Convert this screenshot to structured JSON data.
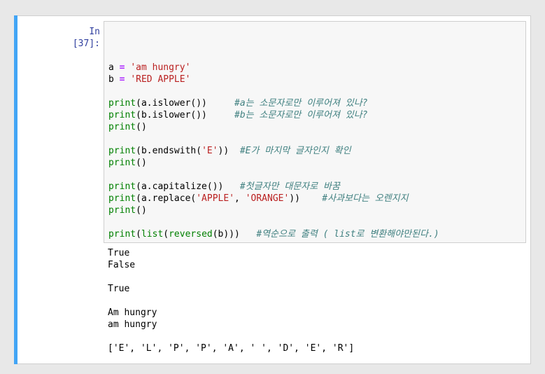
{
  "cell": {
    "prompt": "In [37]:",
    "code_lines": [
      {
        "tokens": []
      },
      {
        "tokens": [
          [
            "plain",
            "a "
          ],
          [
            "op",
            "="
          ],
          [
            "plain",
            " "
          ],
          [
            "str",
            "'am hungry'"
          ]
        ]
      },
      {
        "tokens": [
          [
            "plain",
            "b "
          ],
          [
            "op",
            "="
          ],
          [
            "plain",
            " "
          ],
          [
            "str",
            "'RED APPLE'"
          ]
        ]
      },
      {
        "tokens": []
      },
      {
        "tokens": [
          [
            "fn",
            "print"
          ],
          [
            "plain",
            "(a.islower())     "
          ],
          [
            "cm",
            "#a는 소문자로만 이루어져 있나?"
          ]
        ]
      },
      {
        "tokens": [
          [
            "fn",
            "print"
          ],
          [
            "plain",
            "(b.islower())     "
          ],
          [
            "cm",
            "#b는 소문자로만 이루어져 있나?"
          ]
        ]
      },
      {
        "tokens": [
          [
            "fn",
            "print"
          ],
          [
            "plain",
            "()"
          ]
        ]
      },
      {
        "tokens": []
      },
      {
        "tokens": [
          [
            "fn",
            "print"
          ],
          [
            "plain",
            "(b.endswith("
          ],
          [
            "str",
            "'E'"
          ],
          [
            "plain",
            "))  "
          ],
          [
            "cm",
            "#E가 마지막 글자인지 확인"
          ]
        ]
      },
      {
        "tokens": [
          [
            "fn",
            "print"
          ],
          [
            "plain",
            "()"
          ]
        ]
      },
      {
        "tokens": []
      },
      {
        "tokens": [
          [
            "fn",
            "print"
          ],
          [
            "plain",
            "(a.capitalize())   "
          ],
          [
            "cm",
            "#첫글자만 대문자로 바꿈"
          ]
        ]
      },
      {
        "tokens": [
          [
            "fn",
            "print"
          ],
          [
            "plain",
            "(a.replace("
          ],
          [
            "str",
            "'APPLE'"
          ],
          [
            "plain",
            ", "
          ],
          [
            "str",
            "'ORANGE'"
          ],
          [
            "plain",
            "))    "
          ],
          [
            "cm",
            "#사과보다는 오렌지지"
          ]
        ]
      },
      {
        "tokens": [
          [
            "fn",
            "print"
          ],
          [
            "plain",
            "()"
          ]
        ]
      },
      {
        "tokens": []
      },
      {
        "tokens": [
          [
            "fn",
            "print"
          ],
          [
            "plain",
            "("
          ],
          [
            "fn",
            "list"
          ],
          [
            "plain",
            "("
          ],
          [
            "fn",
            "reversed"
          ],
          [
            "plain",
            "(b)))   "
          ],
          [
            "cm",
            "#역순으로 출력 ( list로 변환해야만된다.)"
          ]
        ]
      }
    ],
    "output_lines": [
      "True",
      "False",
      "",
      "True",
      "",
      "Am hungry",
      "am hungry",
      "",
      "['E', 'L', 'P', 'P', 'A', ' ', 'D', 'E', 'R']"
    ]
  }
}
